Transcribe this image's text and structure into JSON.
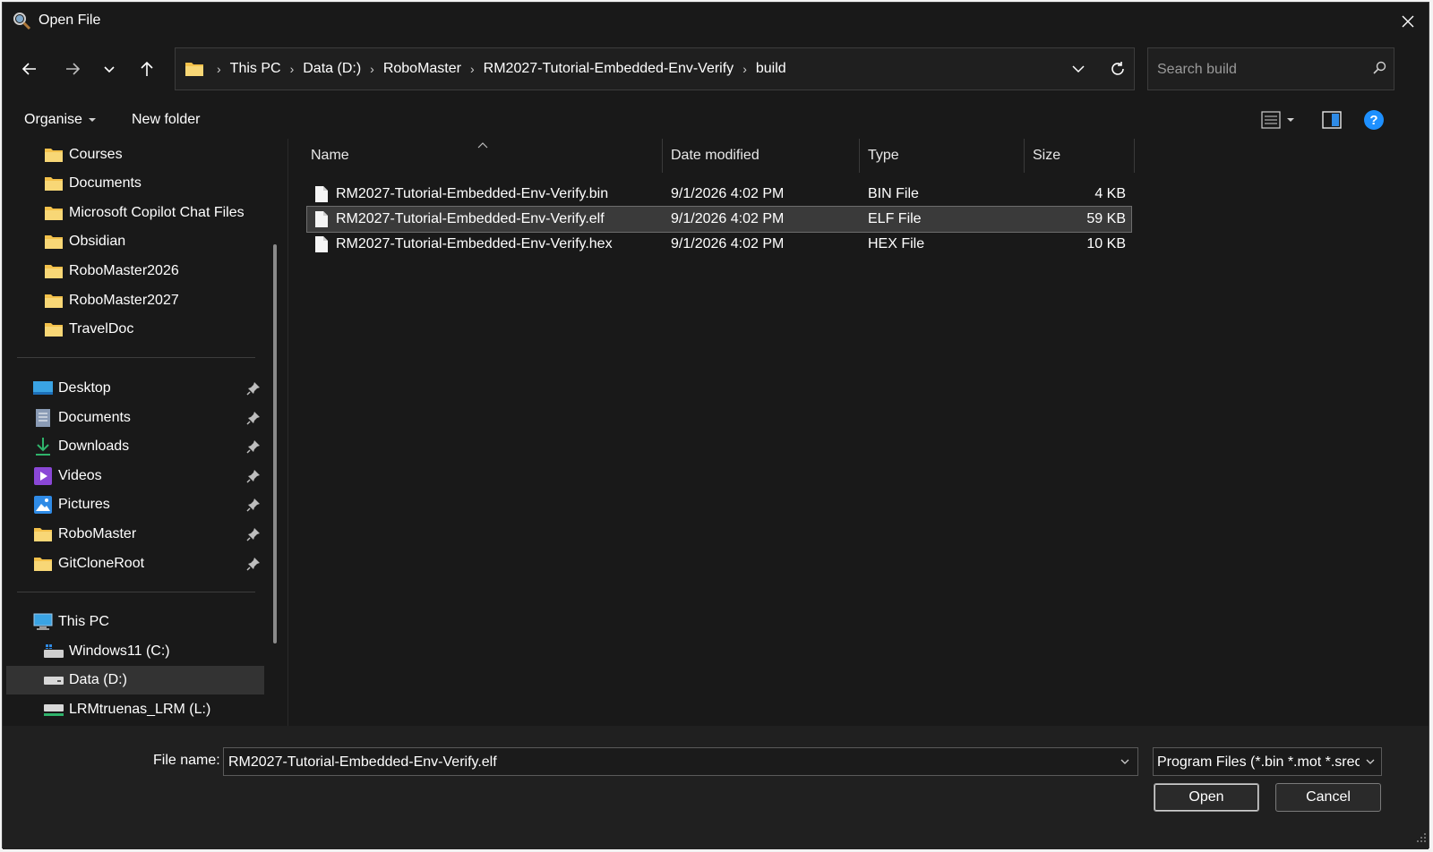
{
  "window": {
    "title": "Open File"
  },
  "address": {
    "crumbs": [
      "This PC",
      "Data (D:)",
      "RoboMaster",
      "RM2027-Tutorial-Embedded-Env-Verify",
      "build"
    ]
  },
  "search": {
    "placeholder": "Search build"
  },
  "toolbar": {
    "organise_label": "Organise",
    "new_folder_label": "New folder"
  },
  "sidebar": {
    "folders": [
      "Courses",
      "Documents",
      "Microsoft Copilot Chat Files",
      "Obsidian",
      "RoboMaster2026",
      "RoboMaster2027",
      "TravelDoc"
    ],
    "quick_access": [
      {
        "label": "Desktop",
        "icon": "desktop-icon"
      },
      {
        "label": "Documents",
        "icon": "documents-icon"
      },
      {
        "label": "Downloads",
        "icon": "download-icon"
      },
      {
        "label": "Videos",
        "icon": "videos-icon"
      },
      {
        "label": "Pictures",
        "icon": "pictures-icon"
      },
      {
        "label": "RoboMaster",
        "icon": "folder-icon"
      },
      {
        "label": "GitCloneRoot",
        "icon": "folder-icon"
      }
    ],
    "this_pc": "This PC",
    "drives": [
      {
        "label": "Windows11 (C:)",
        "icon": "windows-drive-icon"
      },
      {
        "label": "Data (D:)",
        "icon": "drive-icon",
        "selected": true
      },
      {
        "label": "LRMtruenas_LRM (L:)",
        "icon": "network-drive-icon"
      }
    ]
  },
  "file_list": {
    "columns": [
      "Name",
      "Date modified",
      "Type",
      "Size"
    ],
    "rows": [
      {
        "name": "RM2027-Tutorial-Embedded-Env-Verify.bin",
        "date": "9/1/2026 4:02 PM",
        "type": "BIN File",
        "size": "4 KB",
        "selected": false
      },
      {
        "name": "RM2027-Tutorial-Embedded-Env-Verify.elf",
        "date": "9/1/2026 4:02 PM",
        "type": "ELF File",
        "size": "59 KB",
        "selected": true
      },
      {
        "name": "RM2027-Tutorial-Embedded-Env-Verify.hex",
        "date": "9/1/2026 4:02 PM",
        "type": "HEX File",
        "size": "10 KB",
        "selected": false
      }
    ]
  },
  "footer": {
    "file_name_label": "File name:",
    "file_name_value": "RM2027-Tutorial-Embedded-Env-Verify.elf",
    "filter_value": "Program Files (*.bin *.mot *.srec",
    "open_label": "Open",
    "cancel_label": "Cancel"
  },
  "colors": {
    "background": "#191919",
    "accent": "#1e90ff",
    "folder": "#f3c14b"
  }
}
